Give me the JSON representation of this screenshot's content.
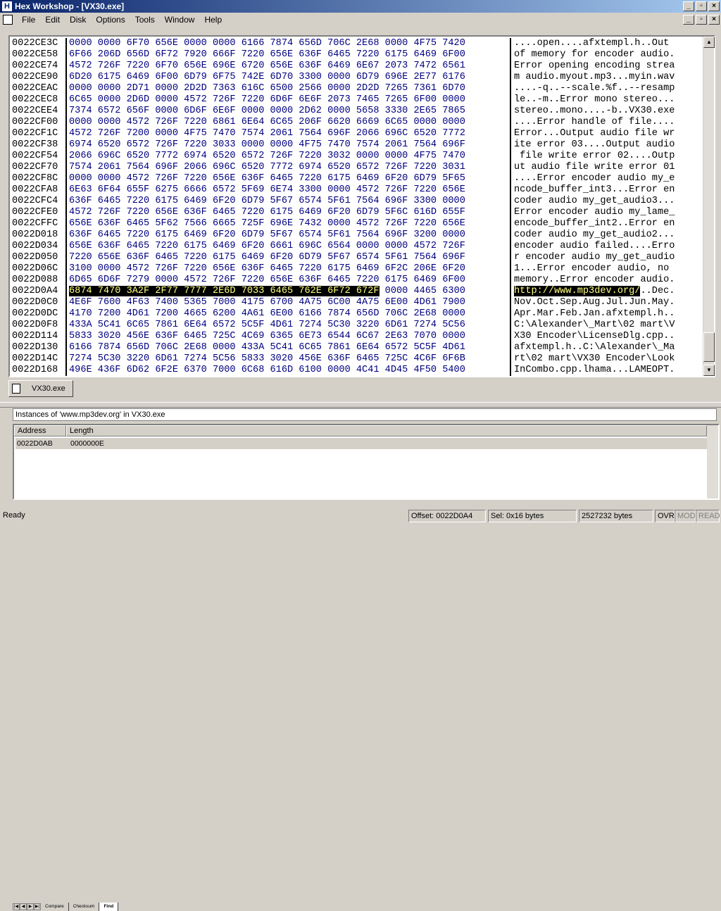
{
  "window": {
    "title": "Hex Workshop - [VX30.exe]",
    "app_icon": "H",
    "buttons": [
      "_",
      "▫",
      "×"
    ]
  },
  "menu": [
    "File",
    "Edit",
    "Disk",
    "Options",
    "Tools",
    "Window",
    "Help"
  ],
  "editor": {
    "rows": [
      {
        "addr": "0022CE3C",
        "hex": "0000 0000 6F70 656E 0000 0000 6166 7874 656D 706C 2E68 0000 4F75 7420",
        "ascii": "....open....afxtempl.h..Out "
      },
      {
        "addr": "0022CE58",
        "hex": "6F66 206D 656D 6F72 7920 666F 7220 656E 636F 6465 7220 6175 6469 6F00",
        "ascii": "of memory for encoder audio."
      },
      {
        "addr": "0022CE74",
        "hex": "4572 726F 7220 6F70 656E 696E 6720 656E 636F 6469 6E67 2073 7472 6561",
        "ascii": "Error opening encoding strea"
      },
      {
        "addr": "0022CE90",
        "hex": "6D20 6175 6469 6F00 6D79 6F75 742E 6D70 3300 0000 6D79 696E 2E77 6176",
        "ascii": "m audio.myout.mp3...myin.wav"
      },
      {
        "addr": "0022CEAC",
        "hex": "0000 0000 2D71 0000 2D2D 7363 616C 6500 2566 0000 2D2D 7265 7361 6D70",
        "ascii": "....-q..--scale.%f..--resamp"
      },
      {
        "addr": "0022CEC8",
        "hex": "6C65 0000 2D6D 0000 4572 726F 7220 6D6F 6E6F 2073 7465 7265 6F00 0000",
        "ascii": "le..-m..Error mono stereo..."
      },
      {
        "addr": "0022CEE4",
        "hex": "7374 6572 656F 0000 6D6F 6E6F 0000 0000 2D62 0000 5658 3330 2E65 7865",
        "ascii": "stereo..mono....-b..VX30.exe"
      },
      {
        "addr": "0022CF00",
        "hex": "0000 0000 4572 726F 7220 6861 6E64 6C65 206F 6620 6669 6C65 0000 0000",
        "ascii": "....Error handle of file...."
      },
      {
        "addr": "0022CF1C",
        "hex": "4572 726F 7200 0000 4F75 7470 7574 2061 7564 696F 2066 696C 6520 7772",
        "ascii": "Error...Output audio file wr"
      },
      {
        "addr": "0022CF38",
        "hex": "6974 6520 6572 726F 7220 3033 0000 0000 4F75 7470 7574 2061 7564 696F",
        "ascii": "ite error 03....Output audio"
      },
      {
        "addr": "0022CF54",
        "hex": "2066 696C 6520 7772 6974 6520 6572 726F 7220 3032 0000 0000 4F75 7470",
        "ascii": " file write error 02....Outp"
      },
      {
        "addr": "0022CF70",
        "hex": "7574 2061 7564 696F 2066 696C 6520 7772 6974 6520 6572 726F 7220 3031",
        "ascii": "ut audio file write error 01"
      },
      {
        "addr": "0022CF8C",
        "hex": "0000 0000 4572 726F 7220 656E 636F 6465 7220 6175 6469 6F20 6D79 5F65",
        "ascii": "....Error encoder audio my_e"
      },
      {
        "addr": "0022CFA8",
        "hex": "6E63 6F64 655F 6275 6666 6572 5F69 6E74 3300 0000 4572 726F 7220 656E",
        "ascii": "ncode_buffer_int3...Error en"
      },
      {
        "addr": "0022CFC4",
        "hex": "636F 6465 7220 6175 6469 6F20 6D79 5F67 6574 5F61 7564 696F 3300 0000",
        "ascii": "coder audio my_get_audio3..."
      },
      {
        "addr": "0022CFE0",
        "hex": "4572 726F 7220 656E 636F 6465 7220 6175 6469 6F20 6D79 5F6C 616D 655F",
        "ascii": "Error encoder audio my_lame_"
      },
      {
        "addr": "0022CFFC",
        "hex": "656E 636F 6465 5F62 7566 6665 725F 696E 7432 0000 4572 726F 7220 656E",
        "ascii": "encode_buffer_int2..Error en"
      },
      {
        "addr": "0022D018",
        "hex": "636F 6465 7220 6175 6469 6F20 6D79 5F67 6574 5F61 7564 696F 3200 0000",
        "ascii": "coder audio my_get_audio2..."
      },
      {
        "addr": "0022D034",
        "hex": "656E 636F 6465 7220 6175 6469 6F20 6661 696C 6564 0000 0000 4572 726F",
        "ascii": "encoder audio failed....Erro"
      },
      {
        "addr": "0022D050",
        "hex": "7220 656E 636F 6465 7220 6175 6469 6F20 6D79 5F67 6574 5F61 7564 696F",
        "ascii": "r encoder audio my_get_audio"
      },
      {
        "addr": "0022D06C",
        "hex": "3100 0000 4572 726F 7220 656E 636F 6465 7220 6175 6469 6F2C 206E 6F20",
        "ascii": "1...Error encoder audio, no "
      },
      {
        "addr": "0022D088",
        "hex": "6D65 6D6F 7279 0000 4572 726F 7220 656E 636F 6465 7220 6175 6469 6F00",
        "ascii": "memory..Error encoder audio."
      },
      {
        "addr": "0022D0A4",
        "hex": "6874 7470 3A2F 2F77 7777 2E6D 7033 6465 762E 6F72 672F 0000 4465 6300",
        "ascii": "http://www.mp3dev.org/..Dec.",
        "highlight": true
      },
      {
        "addr": "0022D0C0",
        "hex": "4E6F 7600 4F63 7400 5365 7000 4175 6700 4A75 6C00 4A75 6E00 4D61 7900",
        "ascii": "Nov.Oct.Sep.Aug.Jul.Jun.May."
      },
      {
        "addr": "0022D0DC",
        "hex": "4170 7200 4D61 7200 4665 6200 4A61 6E00 6166 7874 656D 706C 2E68 0000",
        "ascii": "Apr.Mar.Feb.Jan.afxtempl.h.."
      },
      {
        "addr": "0022D0F8",
        "hex": "433A 5C41 6C65 7861 6E64 6572 5C5F 4D61 7274 5C30 3220 6D61 7274 5C56",
        "ascii": "C:\\Alexander\\_Mart\\02 mart\\V"
      },
      {
        "addr": "0022D114",
        "hex": "5833 3020 456E 636F 6465 725C 4C69 6365 6E73 6544 6C67 2E63 7070 0000",
        "ascii": "X30 Encoder\\LicenseDlg.cpp.."
      },
      {
        "addr": "0022D130",
        "hex": "6166 7874 656D 706C 2E68 0000 433A 5C41 6C65 7861 6E64 6572 5C5F 4D61",
        "ascii": "afxtempl.h..C:\\Alexander\\_Ma"
      },
      {
        "addr": "0022D14C",
        "hex": "7274 5C30 3220 6D61 7274 5C56 5833 3020 456E 636F 6465 725C 4C6F 6F6B",
        "ascii": "rt\\02 mart\\VX30 Encoder\\Look"
      },
      {
        "addr": "0022D168",
        "hex": "496E 436F 6D62 6F2E 6370 7000 6C68 616D 6100 0000 4C41 4D45 4F50 5400",
        "ascii": "InCombo.cpp.lhama...LAMEOPT."
      }
    ],
    "highlight_bytes": 22
  },
  "doc_tab": "VX30.exe",
  "find": {
    "title": "Instances of 'www.mp3dev.org' in VX30.exe",
    "columns": [
      "Address",
      "Length"
    ],
    "results": [
      {
        "address": "0022D0AB",
        "length": "0000000E"
      }
    ],
    "tabs": [
      "Compare",
      "Checksum",
      "Find"
    ],
    "active_tab": "Find"
  },
  "status": {
    "ready": "Ready",
    "offset": "Offset: 0022D0A4",
    "sel": "Sel: 0x16 bytes",
    "size": "2527232 bytes",
    "ovr": "OVR",
    "mod": "MOD",
    "read": "READ"
  }
}
